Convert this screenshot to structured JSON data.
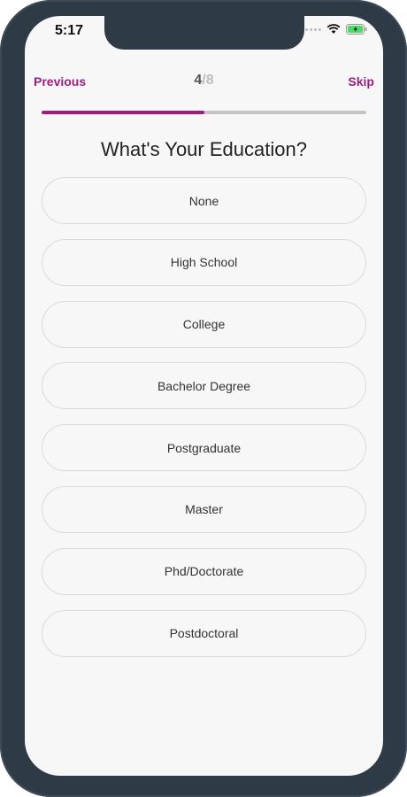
{
  "status": {
    "time": "5:17"
  },
  "nav": {
    "previous_label": "Previous",
    "skip_label": "Skip",
    "step_current": "4",
    "step_total": "/8"
  },
  "progress": {
    "value": 0.5
  },
  "title": "What's Your Education?",
  "options": [
    {
      "label": "None"
    },
    {
      "label": "High School"
    },
    {
      "label": "College"
    },
    {
      "label": "Bachelor Degree"
    },
    {
      "label": "Postgraduate"
    },
    {
      "label": "Master"
    },
    {
      "label": "Phd/Doctorate"
    },
    {
      "label": "Postdoctoral"
    }
  ],
  "colors": {
    "accent": "#9c1f80",
    "frame": "#2f3a47",
    "screen_bg": "#f7f7f8"
  },
  "icons": [
    "signal-icon",
    "wifi-icon",
    "battery-icon"
  ]
}
